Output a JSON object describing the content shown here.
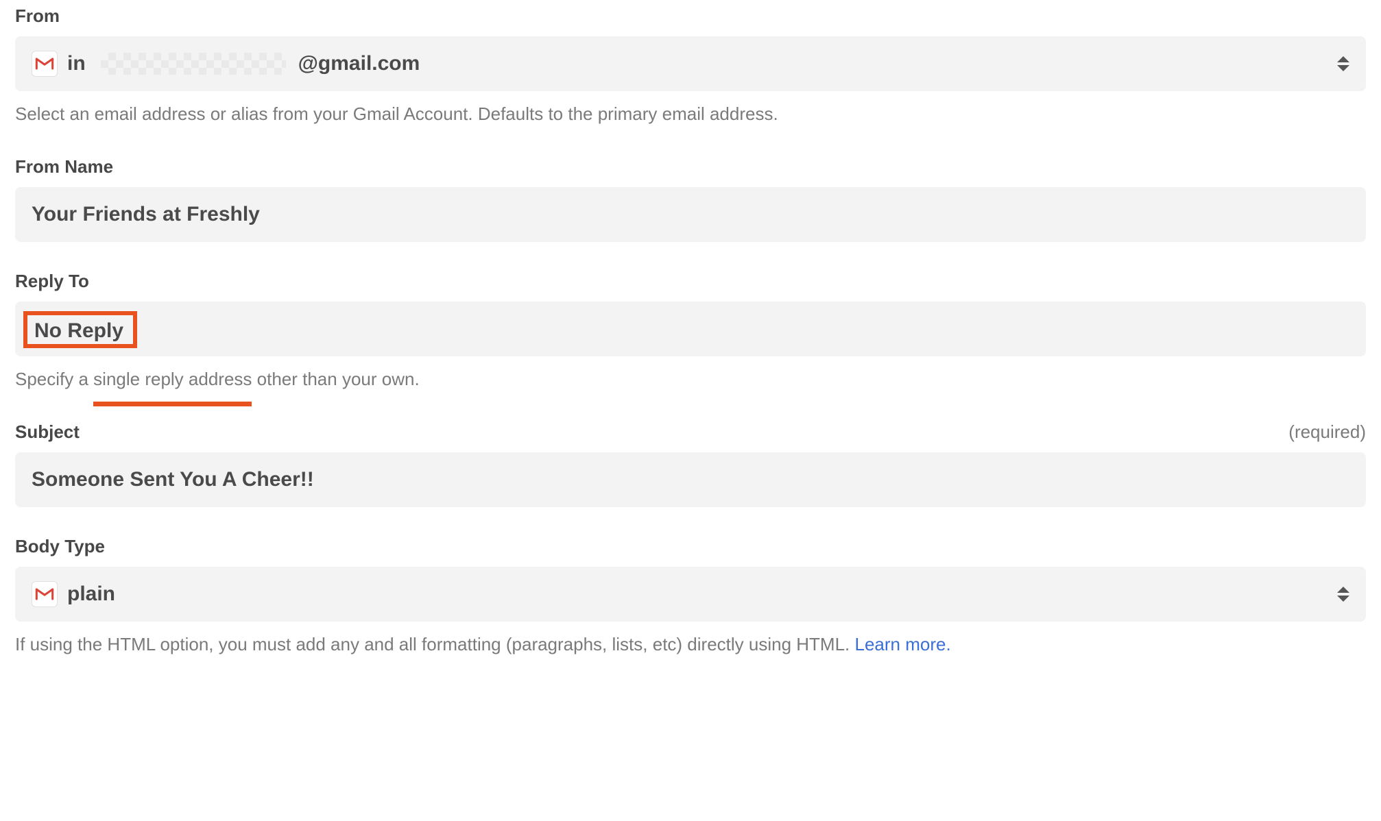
{
  "from": {
    "label": "From",
    "value_prefix": "in",
    "value_suffix": "@gmail.com",
    "help": "Select an email address or alias from your Gmail Account. Defaults to the primary email address."
  },
  "from_name": {
    "label": "From Name",
    "value": "Your Friends at Freshly"
  },
  "reply_to": {
    "label": "Reply To",
    "value": "No Reply",
    "help_before": "Specify a ",
    "help_underlined": "single reply address",
    "help_after": " other than your own."
  },
  "subject": {
    "label": "Subject",
    "required_tag": "(required)",
    "value": "Someone Sent You A Cheer!!"
  },
  "body_type": {
    "label": "Body Type",
    "value": "plain",
    "help_before": "If using the HTML option, you must add any and all formatting (paragraphs, lists, etc) directly using HTML. ",
    "learn_more": "Learn more."
  }
}
